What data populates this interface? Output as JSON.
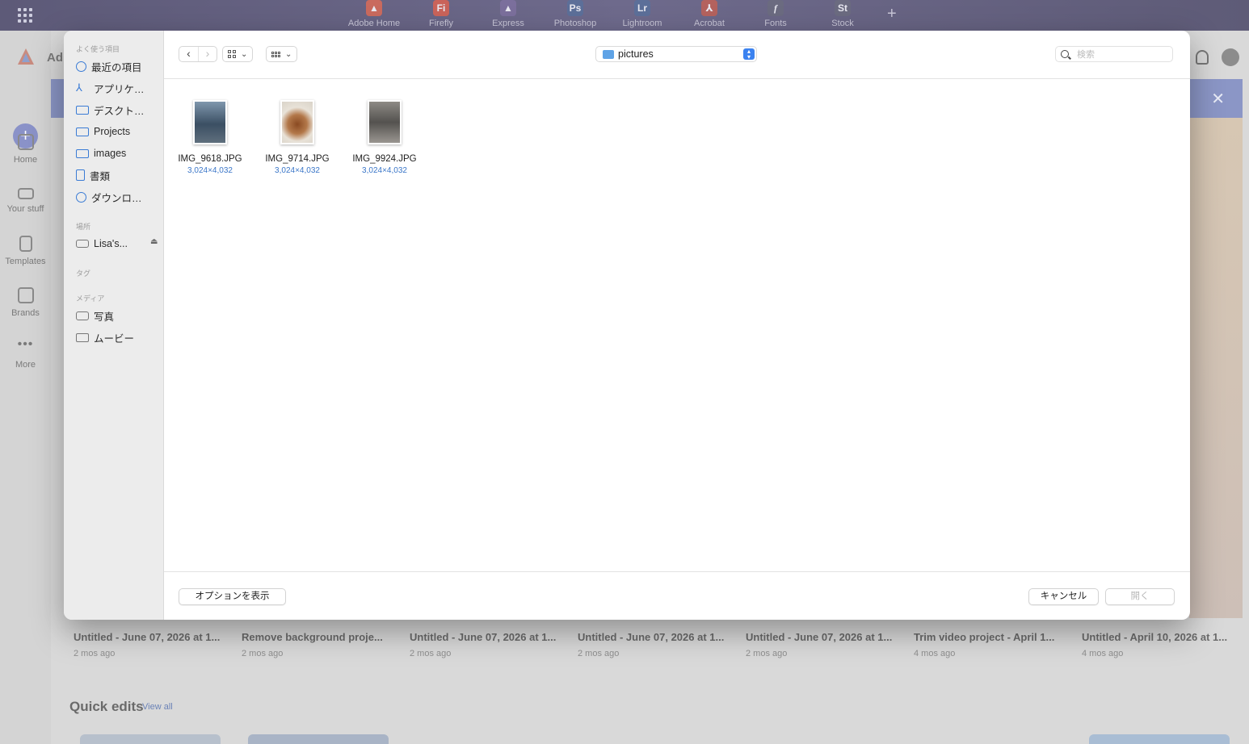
{
  "topbar": {
    "apps": [
      {
        "label": "Adobe Home",
        "logo": "",
        "color": "#c96a5e",
        "icon": "adobe-logo-icon"
      },
      {
        "label": "Firefly",
        "logo": "Fi",
        "color": "#c9635a",
        "icon": "firefly-icon"
      },
      {
        "label": "Express",
        "logo": "",
        "color": "#7b6f9c",
        "icon": "express-icon"
      },
      {
        "label": "Photoshop",
        "logo": "Ps",
        "color": "#5c6f99",
        "icon": "photoshop-icon"
      },
      {
        "label": "Lightroom",
        "logo": "Lr",
        "color": "#5c6f99",
        "icon": "lightroom-icon"
      },
      {
        "label": "Acrobat",
        "logo": "",
        "color": "#b4625e",
        "icon": "acrobat-icon"
      },
      {
        "label": "Fonts",
        "logo": "f",
        "color": "#6b6b80",
        "icon": "fonts-icon"
      },
      {
        "label": "Stock",
        "logo": "St",
        "color": "#6b6b80",
        "icon": "stock-icon"
      }
    ],
    "add_label": "+"
  },
  "app": {
    "brand_text": "Ad",
    "create_label": "+",
    "rail": [
      {
        "label": "Home",
        "icon": "home-icon"
      },
      {
        "label": "Your stuff",
        "icon": "folder-icon"
      },
      {
        "label": "Templates",
        "icon": "templates-icon"
      },
      {
        "label": "Brands",
        "icon": "brands-icon"
      },
      {
        "label": "More",
        "icon": "more-icon"
      }
    ],
    "banner_close": "✕",
    "recent": [
      {
        "title": "Untitled - June 07, 2026 at 1...",
        "time": "2 mos ago"
      },
      {
        "title": "Remove background proje...",
        "time": "2 mos ago"
      },
      {
        "title": "Untitled - June 07, 2026 at 1...",
        "time": "2 mos ago"
      },
      {
        "title": "Untitled - June 07, 2026 at 1...",
        "time": "2 mos ago"
      },
      {
        "title": "Untitled - June 07, 2026 at 1...",
        "time": "2 mos ago"
      },
      {
        "title": "Trim video project - April 1...",
        "time": "4 mos ago"
      },
      {
        "title": "Untitled - April 10, 2026 at 1...",
        "time": "4 mos ago"
      }
    ],
    "quick_edits_title": "Quick edits",
    "view_all": "View all"
  },
  "dialog": {
    "sidebar": {
      "favorites_header": "よく使う項目",
      "favorites": [
        {
          "label": "最近の項目",
          "icon": "clock-icon"
        },
        {
          "label": "アプリケ…",
          "icon": "applications-icon"
        },
        {
          "label": "デスクト…",
          "icon": "desktop-icon"
        },
        {
          "label": "Projects",
          "icon": "folder-icon"
        },
        {
          "label": "images",
          "icon": "folder-icon"
        },
        {
          "label": "書類",
          "icon": "document-icon"
        },
        {
          "label": "ダウンロ…",
          "icon": "download-icon"
        }
      ],
      "locations_header": "場所",
      "locations": [
        {
          "label": "Lisa's...",
          "icon": "disk-icon"
        }
      ],
      "eject": "⏏",
      "tags_header": "タグ",
      "media_header": "メディア",
      "media": [
        {
          "label": "写真",
          "icon": "camera-icon"
        },
        {
          "label": "ムービー",
          "icon": "film-icon"
        }
      ]
    },
    "toolbar": {
      "back": "‹",
      "forward": "›",
      "view_chevron": "⌄",
      "location": "pictures",
      "search_placeholder": "検索"
    },
    "files": [
      {
        "name": "IMG_9618.JPG",
        "dims": "3,024×4,032",
        "tone": "#4f6a86"
      },
      {
        "name": "IMG_9714.JPG",
        "dims": "3,024×4,032",
        "tone": "#9a6440"
      },
      {
        "name": "IMG_9924.JPG",
        "dims": "3,024×4,032",
        "tone": "#6c6a66"
      }
    ],
    "footer": {
      "options_label": "オプションを表示",
      "cancel_label": "キャンセル",
      "open_label": "開く"
    }
  }
}
